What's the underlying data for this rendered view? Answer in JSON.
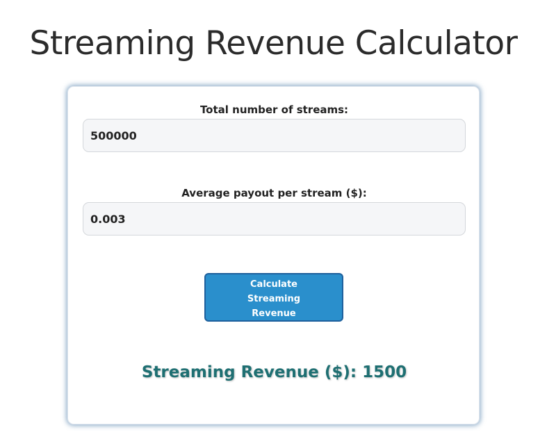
{
  "page": {
    "title": "Streaming Revenue Calculator"
  },
  "form": {
    "streams_label": "Total number of streams:",
    "streams_value": "500000",
    "payout_label": "Average payout per stream ($):",
    "payout_value": "0.003",
    "calculate_button_label": "Calculate Streaming Revenue"
  },
  "result": {
    "label": "Streaming Revenue ($):",
    "value": "1500"
  },
  "colors": {
    "button_background": "#2a8fcc",
    "button_border": "#1d5f9c",
    "result_text": "#1e6f72",
    "card_glow": "#608ab2"
  }
}
